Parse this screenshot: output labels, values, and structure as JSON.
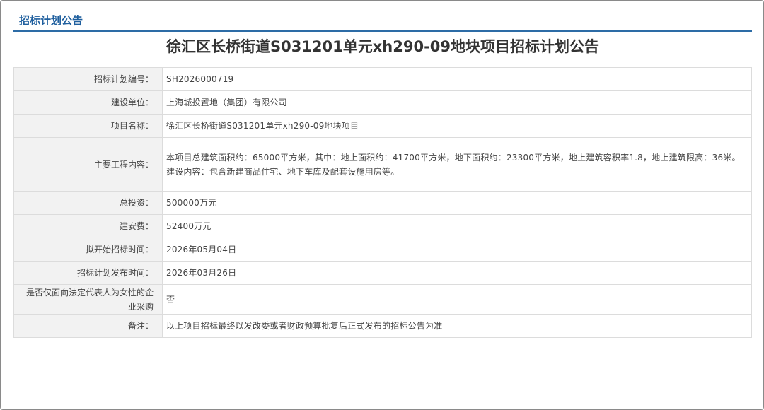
{
  "colors": {
    "accent": "#1f5f9e",
    "rule": "#2d6ca6",
    "label_bg": "#f2f2f2",
    "border": "#dcdcdc"
  },
  "header": {
    "title": "招标计划公告"
  },
  "notice": {
    "title": "徐汇区长桥街道S031201单元xh290-09地块项目招标计划公告"
  },
  "rows": [
    {
      "label": "招标计划编号：",
      "value": "SH2026000719"
    },
    {
      "label": "建设单位：",
      "value": "上海城投置地（集团）有限公司"
    },
    {
      "label": "项目名称：",
      "value": "徐汇区长桥街道S031201单元xh290-09地块项目"
    },
    {
      "label": "主要工程内容：",
      "value": "本项目总建筑面积约：65000平方米，其中：地上面积约：41700平方米，地下面积约：23300平方米，地上建筑容积率1.8，地上建筑限高：36米。建设内容：包含新建商品住宅、地下车库及配套设施用房等。"
    },
    {
      "label": "总投资：",
      "value": "500000万元"
    },
    {
      "label": "建安费：",
      "value": "52400万元"
    },
    {
      "label": "拟开始招标时间：",
      "value": "2026年05月04日"
    },
    {
      "label": "招标计划发布时间：",
      "value": "2026年03月26日"
    },
    {
      "label": "是否仅面向法定代表人为女性的企业采购",
      "value": "否"
    },
    {
      "label": "备注：",
      "value": "以上项目招标最终以发改委或者财政预算批复后正式发布的招标公告为准"
    }
  ]
}
